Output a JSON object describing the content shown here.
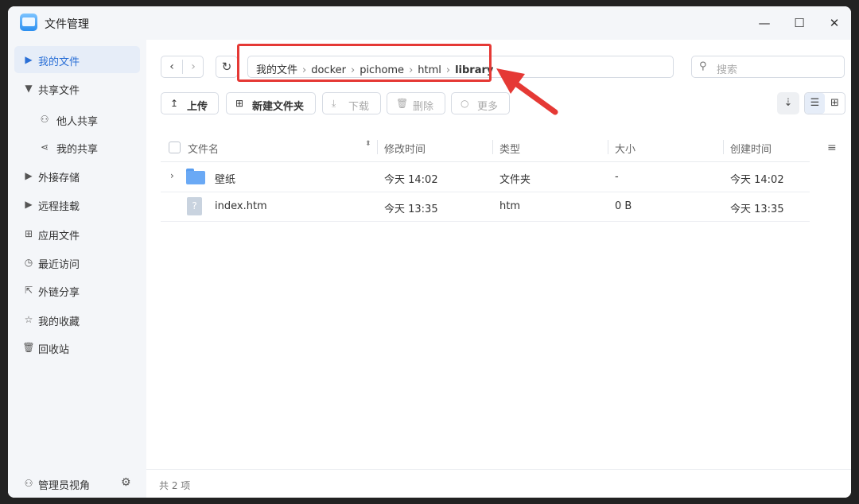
{
  "window": {
    "title": "文件管理",
    "controls": {
      "minimize": "—",
      "maximize": "☐",
      "close": "✕"
    }
  },
  "sidebar": {
    "items": [
      {
        "label": "我的文件",
        "icon": "▶"
      },
      {
        "label": "共享文件",
        "icon": "▼"
      },
      {
        "label": "他人共享",
        "icon": "⚇"
      },
      {
        "label": "我的共享",
        "icon": "⋖"
      },
      {
        "label": "外接存储",
        "icon": "▶"
      },
      {
        "label": "远程挂载",
        "icon": "▶"
      },
      {
        "label": "应用文件",
        "icon": "⊞"
      },
      {
        "label": "最近访问",
        "icon": "◷"
      },
      {
        "label": "外链分享",
        "icon": "⇱"
      },
      {
        "label": "我的收藏",
        "icon": "☆"
      },
      {
        "label": "回收站",
        "icon": "🗑"
      }
    ],
    "footer": {
      "label": "管理员视角",
      "icon": "⚇",
      "settings_icon": "⚙"
    }
  },
  "toolbar": {
    "back": "‹",
    "forward": "›",
    "refresh": "↻",
    "breadcrumb": [
      "我的文件",
      "docker",
      "pichome",
      "html",
      "library"
    ],
    "breadcrumb_sep": "›",
    "search_placeholder": "搜索",
    "search_icon": "⚲",
    "actions": [
      {
        "label": "上传",
        "icon": "↥"
      },
      {
        "label": "新建文件夹",
        "icon": "⊞"
      },
      {
        "label": "下载",
        "icon": "⤓"
      },
      {
        "label": "删除",
        "icon": "🗑"
      },
      {
        "label": "更多",
        "icon": "○"
      }
    ],
    "sort_icon": "⇣",
    "list_view_icon": "☰",
    "grid_view_icon": "⊞"
  },
  "table": {
    "columns": [
      "文件名",
      "修改时间",
      "类型",
      "大小",
      "创建时间"
    ],
    "sort_icon": "⬍",
    "settings_icon": "≡",
    "rows": [
      {
        "name": "壁纸",
        "modified": "今天 14:02",
        "type": "文件夹",
        "size": "-",
        "created": "今天 14:02"
      },
      {
        "name": "index.htm",
        "modified": "今天 13:35",
        "type": "htm",
        "size": "0 B",
        "created": "今天 13:35",
        "file_icon": "?"
      }
    ],
    "expand_icon": "›"
  },
  "status": {
    "text": "共 2 项"
  },
  "colors": {
    "accent": "#2a6fd6",
    "highlight_red": "#e53935",
    "folder_blue": "#6aa9f5"
  }
}
